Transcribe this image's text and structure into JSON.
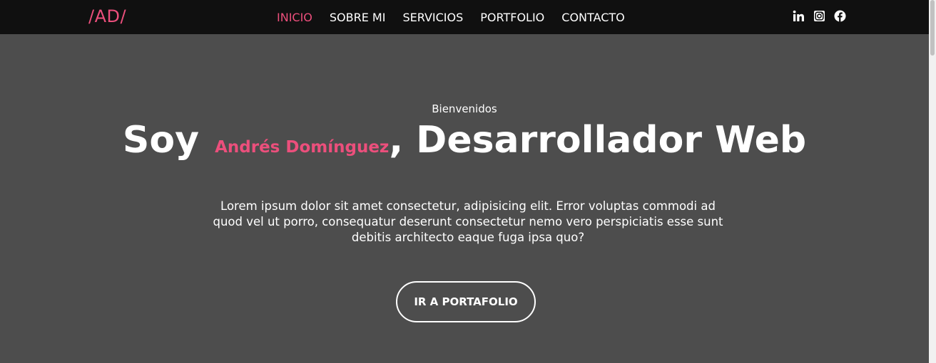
{
  "brand": {
    "logo": "/AD/"
  },
  "nav": {
    "items": [
      {
        "label": "INICIO",
        "active": true
      },
      {
        "label": "SOBRE MI",
        "active": false
      },
      {
        "label": "SERVICIOS",
        "active": false
      },
      {
        "label": "PORTFOLIO",
        "active": false
      },
      {
        "label": "CONTACTO",
        "active": false
      }
    ]
  },
  "social": {
    "icons": [
      "linkedin-icon",
      "instagram-icon",
      "facebook-icon"
    ]
  },
  "hero": {
    "greeting": "Bienvenidos",
    "prefix": "Soy",
    "name": "Andrés Domínguez",
    "suffix": ", Desarrollador Web",
    "description": "Lorem ipsum dolor sit amet consectetur, adipisicing elit. Error voluptas commodi ad quod vel ut porro, consequatur deserunt consectetur nemo vero perspiciatis esse sunt debitis architecto eaque fuga ipsa quo?",
    "cta_label": "IR A PORTAFOLIO"
  },
  "colors": {
    "accent": "#ec4f7c",
    "navbar": "#101010",
    "hero_bg": "#4d4d4d",
    "text": "#ffffff"
  }
}
